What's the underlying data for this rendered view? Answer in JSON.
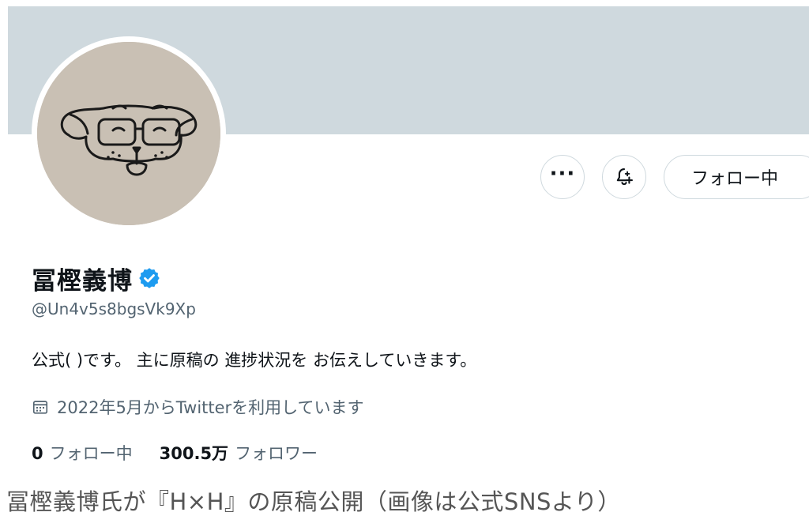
{
  "profile": {
    "display_name": "冨樫義博",
    "handle": "@Un4v5s8bgsVk9Xp",
    "bio": "公式( )です。 主に原稿の 進捗状況を お伝えしていきます。",
    "joined": "2022年5月からTwitterを利用しています",
    "following_count": "0",
    "following_label": "フォロー中",
    "followers_count": "300.5万",
    "followers_label": "フォロワー",
    "verified": true
  },
  "actions": {
    "more_label": "···",
    "follow_label": "フォロー中"
  },
  "icons": {
    "more": "more-horizontal-icon",
    "bell": "notification-bell-plus-icon",
    "verified": "verified-badge-icon",
    "calendar": "calendar-icon"
  },
  "colors": {
    "banner": "#cfd9de",
    "verified": "#1d9bf0",
    "secondary_text": "#536471",
    "primary_text": "#0f1419"
  },
  "caption": "冨樫義博氏が『H×H』の原稿公開（画像は公式SNSより）"
}
